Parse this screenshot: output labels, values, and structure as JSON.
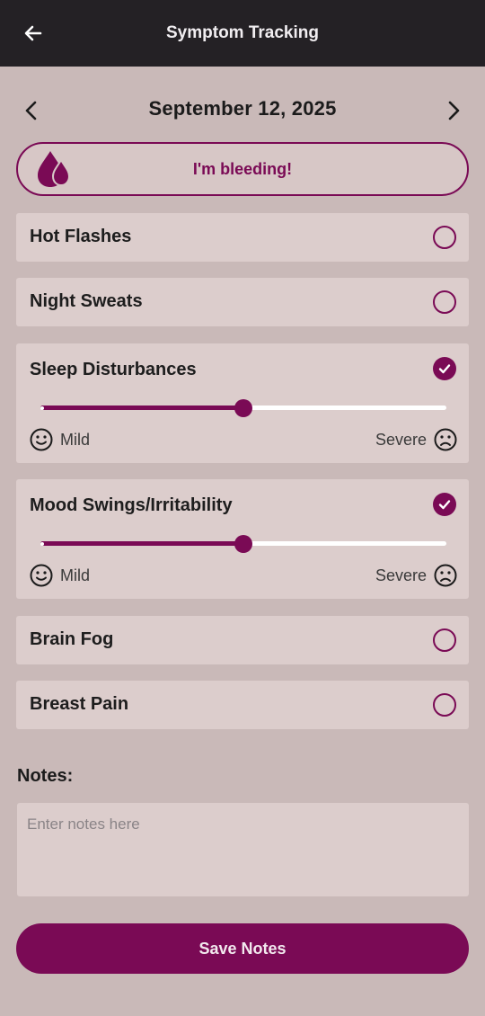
{
  "header": {
    "title": "Symptom Tracking",
    "back_icon": "arrow-left-icon"
  },
  "date": {
    "label": "September 12, 2025",
    "prev_icon": "chevron-left-icon",
    "next_icon": "chevron-right-icon"
  },
  "bleeding": {
    "label": "I'm bleeding!",
    "icon": "blood-drops-icon"
  },
  "symptoms": [
    {
      "name": "Hot Flashes",
      "checked": false
    },
    {
      "name": "Night Sweats",
      "checked": false
    },
    {
      "name": "Sleep Disturbances",
      "checked": true,
      "severity_fraction": 0.5,
      "min_label": "Mild",
      "max_label": "Severe"
    },
    {
      "name": "Mood Swings/Irritability",
      "checked": true,
      "severity_fraction": 0.5,
      "min_label": "Mild",
      "max_label": "Severe"
    },
    {
      "name": "Brain Fog",
      "checked": false
    },
    {
      "name": "Breast Pain",
      "checked": false
    }
  ],
  "notes": {
    "label": "Notes:",
    "placeholder": "Enter notes here",
    "value": ""
  },
  "save_label": "Save Notes",
  "colors": {
    "accent": "#7a0a55",
    "background": "#c9b9b8",
    "card": "#dccdcc",
    "topbar": "#242125"
  }
}
